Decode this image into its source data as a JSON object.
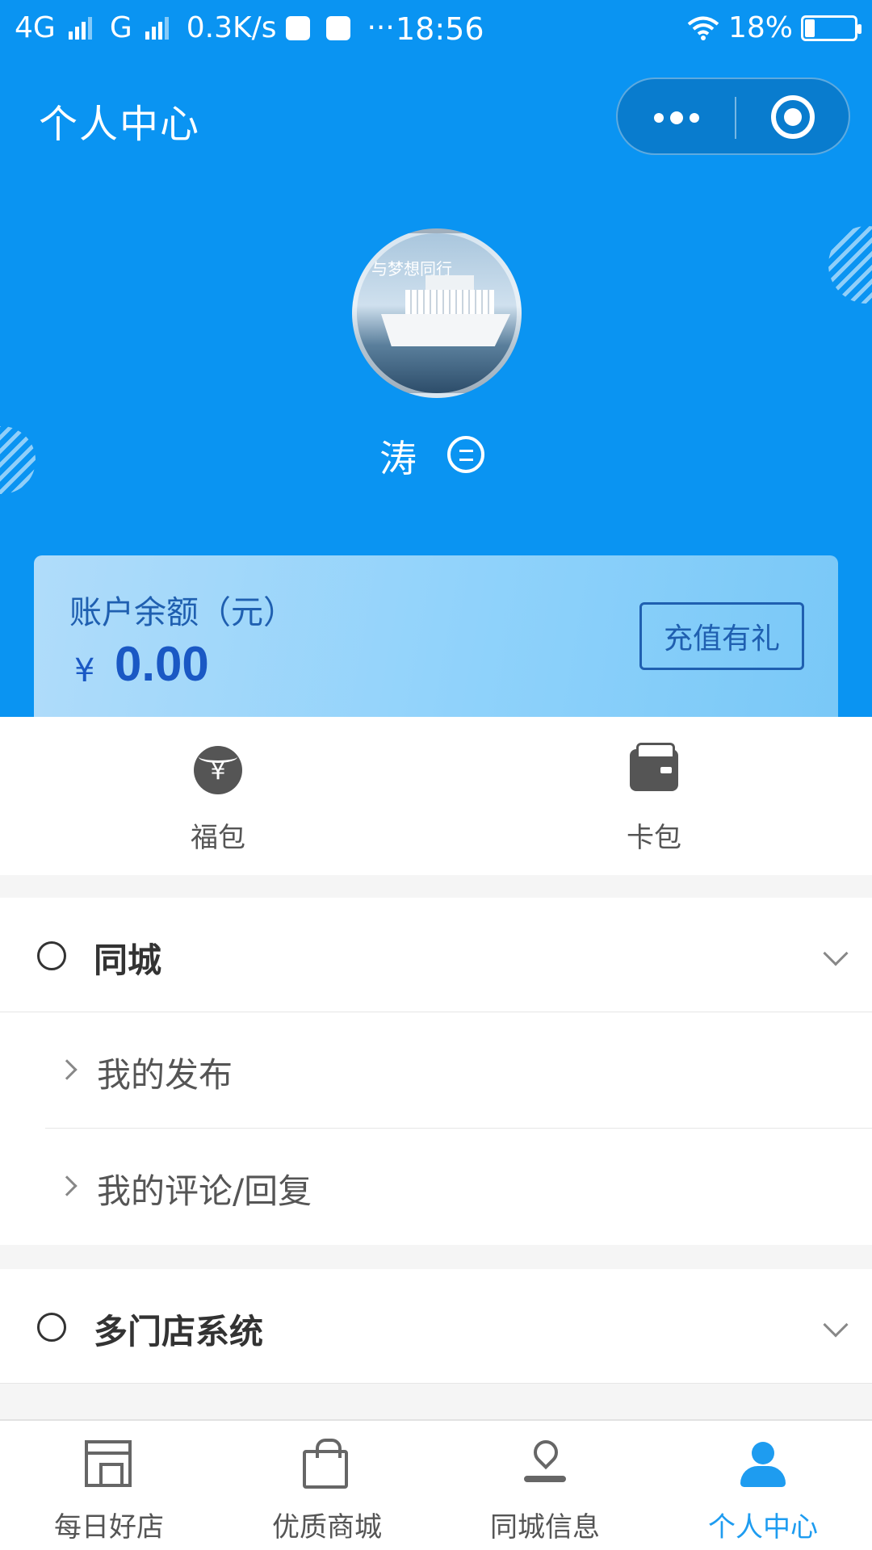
{
  "status_bar": {
    "network1": "4G",
    "network2": "G",
    "speed": "0.3K/s",
    "dots": "···",
    "time": "18:56",
    "battery": "18%"
  },
  "header": {
    "title": "个人中心"
  },
  "profile": {
    "avatar_caption": "与梦想同行",
    "username": "涛"
  },
  "balance": {
    "label": "账户余额（元）",
    "currency": "¥",
    "value": "0.00",
    "recharge_label": "充值有礼"
  },
  "wallet": [
    {
      "label": "福包",
      "icon": "red-packet-icon"
    },
    {
      "label": "卡包",
      "icon": "wallet-icon"
    }
  ],
  "sections": [
    {
      "title": "同城",
      "items": [
        "我的发布",
        "我的评论/回复"
      ]
    },
    {
      "title": "多门店系统",
      "items": []
    }
  ],
  "tabs": [
    {
      "label": "每日好店",
      "icon": "store-icon",
      "active": false
    },
    {
      "label": "优质商城",
      "icon": "shopping-bag-icon",
      "active": false
    },
    {
      "label": "同城信息",
      "icon": "location-pin-icon",
      "active": false
    },
    {
      "label": "个人中心",
      "icon": "user-icon",
      "active": true
    }
  ],
  "colors": {
    "primary": "#0a94f2",
    "tab_active": "#1e9cf0",
    "balance_text": "#1a58c4"
  }
}
